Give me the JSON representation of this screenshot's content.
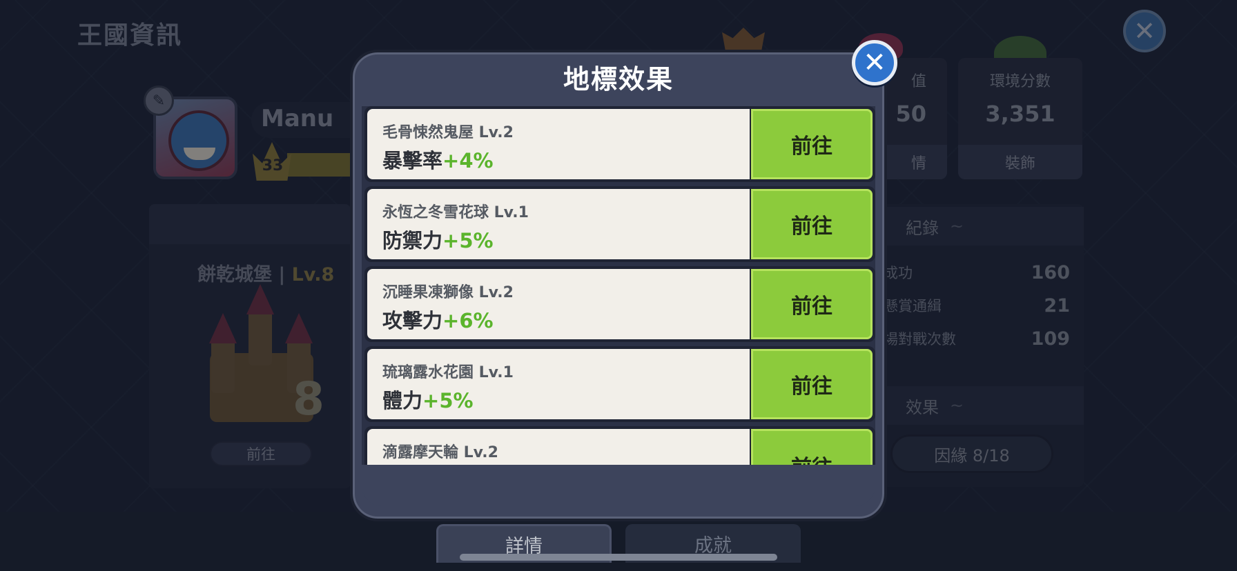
{
  "background": {
    "page_title": "王國資訊",
    "player": {
      "name": "Manu",
      "level": "33"
    },
    "castle": {
      "name": "餅乾城堡",
      "level_label": "Lv.8",
      "level_number": "8",
      "goto_label": "前往"
    },
    "stats": [
      {
        "label": "值",
        "value": "50",
        "footer": "情"
      },
      {
        "label": "環境分數",
        "value": "3,351",
        "footer": "裝飾"
      }
    ],
    "records": {
      "header": "紀錄",
      "rows": [
        {
          "label": "成功",
          "value": "160"
        },
        {
          "label": "懸賞通緝",
          "value": "21"
        },
        {
          "label": "場對戰次數",
          "value": "109"
        }
      ]
    },
    "effects": {
      "header": "效果",
      "bond_label": "因緣 8/18"
    },
    "tabs": [
      {
        "label": "詳情",
        "active": true
      },
      {
        "label": "成就",
        "active": false
      }
    ]
  },
  "modal": {
    "title": "地標效果",
    "items": [
      {
        "name": "毛骨悚然鬼屋 Lv.2",
        "stat": "暴擊率",
        "bonus": "+4%",
        "button": "前往"
      },
      {
        "name": "永恆之冬雪花球 Lv.1",
        "stat": "防禦力",
        "bonus": "+5%",
        "button": "前往"
      },
      {
        "name": "沉睡果凍獅像 Lv.2",
        "stat": "攻擊力",
        "bonus": "+6%",
        "button": "前往"
      },
      {
        "name": "琉璃露水花園 Lv.1",
        "stat": "體力",
        "bonus": "+5%",
        "button": "前往"
      },
      {
        "name": "滴露摩天輪 Lv.2",
        "stat": "",
        "bonus": "",
        "button": "前往"
      }
    ]
  },
  "colors": {
    "accent_green": "#8ccb3c",
    "bonus_green": "#5bb42c",
    "close_blue": "#2f73cc"
  }
}
